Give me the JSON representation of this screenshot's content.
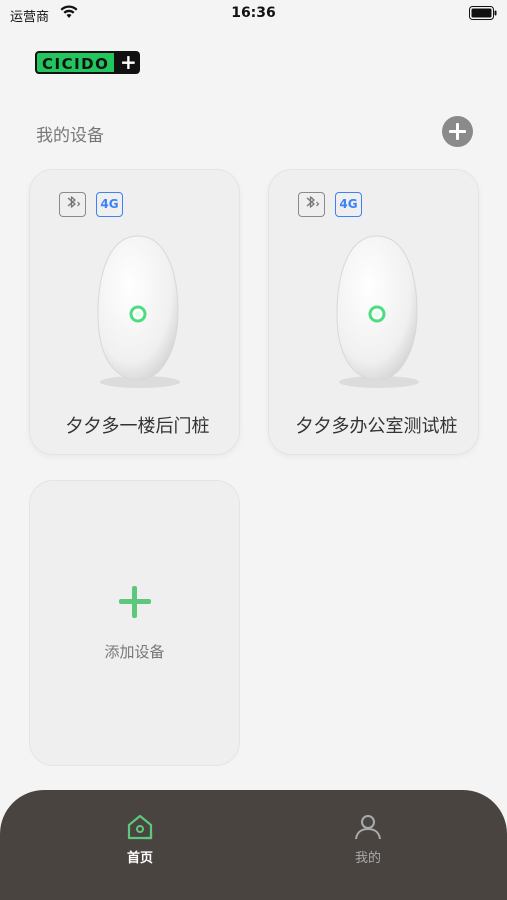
{
  "status_bar": {
    "carrier": "运营商",
    "time": "16:36"
  },
  "logo": {
    "text": "CICIDO",
    "plus": "+"
  },
  "header": {
    "title": "我的设备"
  },
  "devices": [
    {
      "name": "夕夕多一楼后门桩",
      "badges": [
        "bluetooth-icon",
        "4G"
      ]
    },
    {
      "name": "夕夕多办公室测试桩",
      "badges": [
        "bluetooth-icon",
        "4G"
      ]
    }
  ],
  "add_device": {
    "label": "添加设备"
  },
  "tabs": [
    {
      "label": "首页",
      "icon": "home-icon",
      "active": true
    },
    {
      "label": "我的",
      "icon": "person-icon",
      "active": false
    }
  ],
  "colors": {
    "accent": "#5cc77d",
    "brand": "#22c55e",
    "tabbar": "#4a4440",
    "badge_4g": "#3b82f6"
  }
}
